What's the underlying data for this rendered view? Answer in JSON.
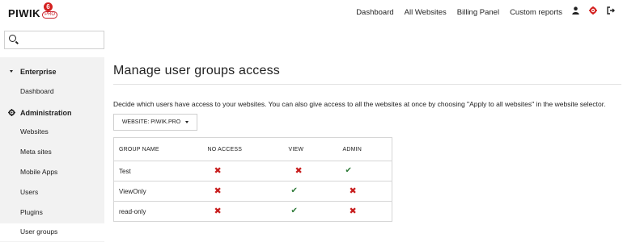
{
  "header": {
    "logo_text": "PIWIK",
    "logo_pro": "PRO",
    "notification_count": "6",
    "nav": [
      {
        "label": "Dashboard"
      },
      {
        "label": "All Websites"
      },
      {
        "label": "Billing Panel"
      },
      {
        "label": "Custom reports"
      }
    ],
    "icons": [
      "user-icon",
      "gear-icon",
      "logout-icon"
    ]
  },
  "search": {
    "placeholder": ""
  },
  "sidebar": {
    "sections": [
      {
        "label": "Enterprise",
        "icon": "caret-down-icon",
        "items": [
          {
            "label": "Dashboard"
          }
        ]
      },
      {
        "label": "Administration",
        "icon": "gear-icon",
        "items": [
          {
            "label": "Websites"
          },
          {
            "label": "Meta sites"
          },
          {
            "label": "Mobile Apps"
          },
          {
            "label": "Users"
          },
          {
            "label": "Plugins"
          },
          {
            "label": "User groups",
            "active": true
          }
        ]
      }
    ]
  },
  "main": {
    "title": "Manage user groups access",
    "description": "Decide which users have access to your websites. You can also give access to all the websites at once by choosing \"Apply to all websites\" in the website selector.",
    "website_selector": "WEBSITE: PIWIK.PRO",
    "table": {
      "columns": [
        "GROUP NAME",
        "NO ACCESS",
        "VIEW",
        "ADMIN"
      ],
      "rows": [
        {
          "name": "Test",
          "access": [
            "x",
            "x",
            "check"
          ]
        },
        {
          "name": "ViewOnly",
          "access": [
            "x",
            "check",
            "x"
          ]
        },
        {
          "name": "read-only",
          "access": [
            "x",
            "check",
            "x"
          ]
        }
      ]
    }
  },
  "colors": {
    "brand_red": "#d4201f",
    "check_green": "#2e7a38",
    "sidebar_bg": "#f2f2f2"
  }
}
